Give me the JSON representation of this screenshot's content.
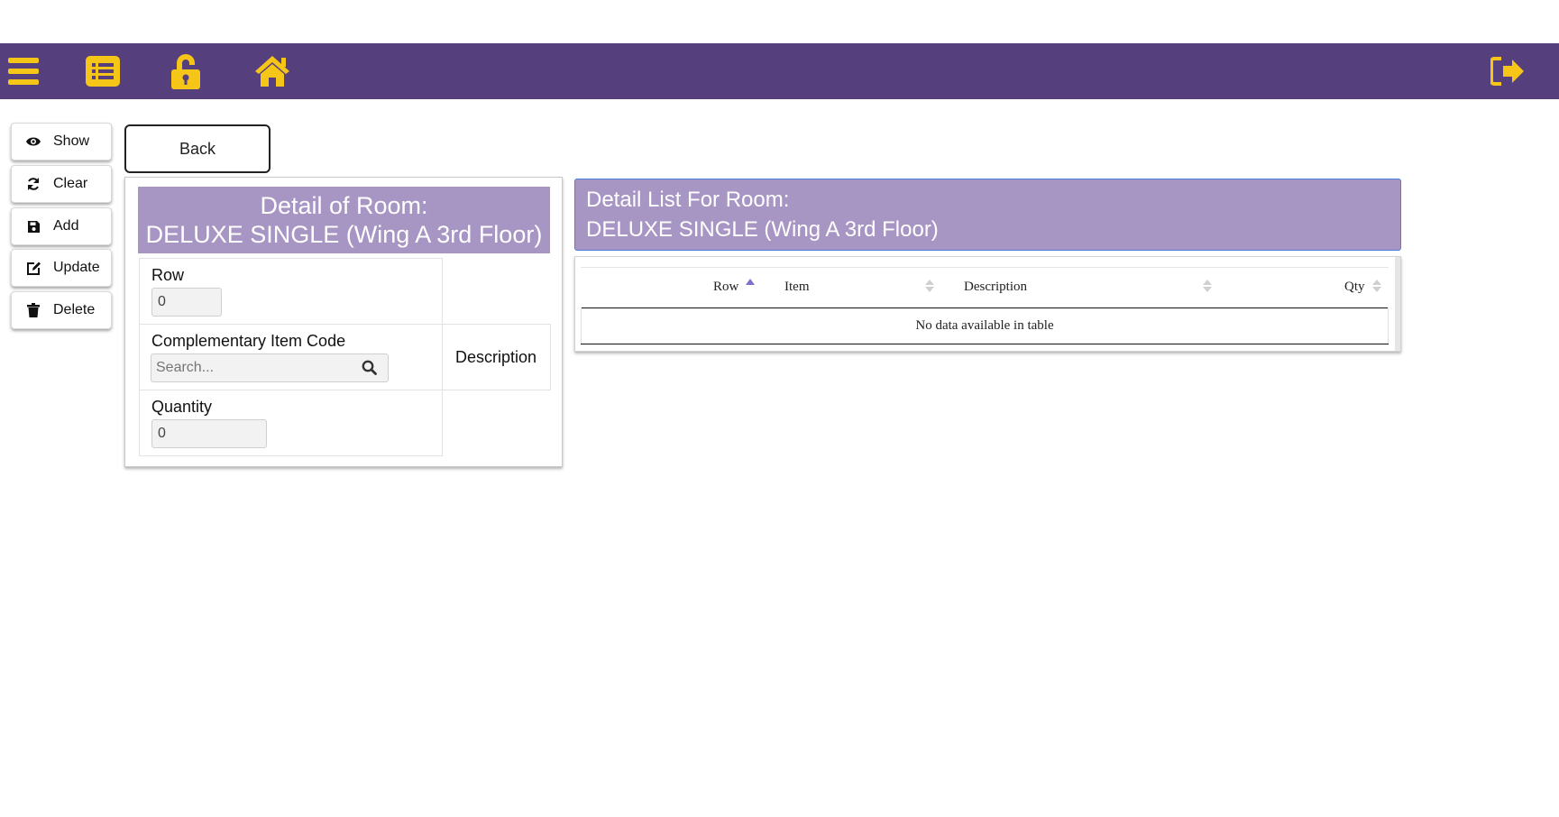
{
  "toolbar": {
    "icons": [
      "menu-icon",
      "list-icon",
      "unlock-icon",
      "home-icon",
      "sign-out-icon"
    ],
    "icon_color": "#f5c518",
    "bar_color": "#553f7c"
  },
  "sidebar": {
    "items": [
      {
        "label": "Show",
        "icon": "eye-icon"
      },
      {
        "label": "Clear",
        "icon": "refresh-icon"
      },
      {
        "label": "Add",
        "icon": "save-icon"
      },
      {
        "label": "Update",
        "icon": "edit-icon"
      },
      {
        "label": "Delete",
        "icon": "trash-icon"
      }
    ]
  },
  "back_label": "Back",
  "detail": {
    "title_line1": "Detail of Room:",
    "title_line2": "DELUXE SINGLE (Wing A 3rd Floor)",
    "row_label": "Row",
    "row_value": "0",
    "item_code_label": "Complementary Item Code",
    "search_placeholder": "Search...",
    "description_label": "Description",
    "quantity_label": "Quantity",
    "quantity_value": "0"
  },
  "list": {
    "title_line1": "Detail List For Room:",
    "title_line2": "DELUXE SINGLE (Wing A 3rd Floor)",
    "columns": [
      "Row",
      "Item",
      "Description",
      "Qty"
    ],
    "sorted_column": "Row",
    "sort_direction": "ascending",
    "empty_message": "No data available in table"
  },
  "colors": {
    "header_fill": "#a795c4",
    "accent_border": "#4b7ce0",
    "sort_active": "#7b70c9",
    "sort_inactive": "#d0d0d0"
  }
}
